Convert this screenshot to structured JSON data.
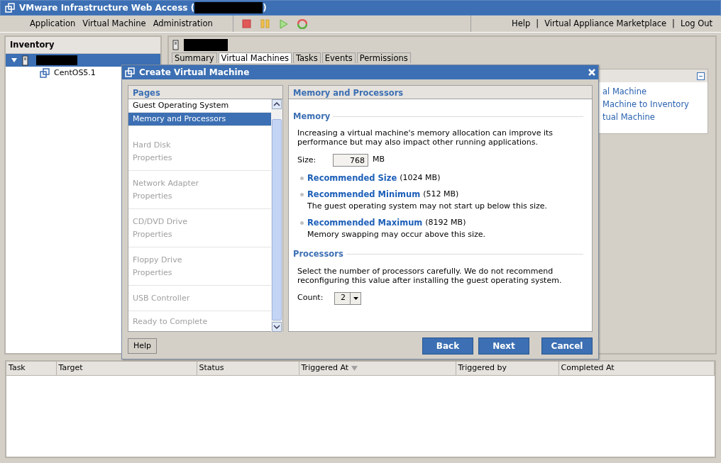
{
  "window": {
    "title_prefix": "VMware Infrastructure Web Access (",
    "title_suffix": ")"
  },
  "menu": [
    "Application",
    "Virtual Machine",
    "Administration"
  ],
  "toolbar": [
    {
      "kind": "stop"
    },
    {
      "kind": "pause"
    },
    {
      "kind": "play"
    },
    {
      "kind": "reset"
    }
  ],
  "top_links": [
    "Help",
    "Virtual Appliance Marketplace",
    "Log Out"
  ],
  "link_separator": "|",
  "inventory": {
    "title": "Inventory",
    "tree": [
      {
        "kind": "host",
        "selected": true,
        "expanded": true,
        "children": [
          {
            "kind": "vm",
            "label": "CentOS5.1",
            "selected": false
          }
        ]
      }
    ]
  },
  "content": {
    "tabs": [
      {
        "label": "Summary",
        "selected": false
      },
      {
        "label": "Virtual Machines",
        "selected": true
      },
      {
        "label": "Tasks",
        "selected": false
      },
      {
        "label": "Events",
        "selected": false
      },
      {
        "label": "Permissions",
        "selected": false
      }
    ],
    "commands": [
      "al Machine",
      "Machine to Inventory",
      "tual Machine"
    ]
  },
  "dialog": {
    "title": "Create Virtual Machine",
    "pages_title": "Pages",
    "pages": [
      {
        "lines": [
          "Guest Operating System"
        ],
        "selected": false,
        "disabled": false
      },
      {
        "lines": [
          "Memory and Processors"
        ],
        "selected": true,
        "disabled": false
      },
      {
        "lines": [
          "Hard Disk",
          "Properties"
        ],
        "selected": false,
        "disabled": true
      },
      {
        "lines": [
          "Network Adapter",
          "Properties"
        ],
        "selected": false,
        "disabled": true
      },
      {
        "lines": [
          "CD/DVD Drive",
          "Properties"
        ],
        "selected": false,
        "disabled": true
      },
      {
        "lines": [
          "Floppy Drive",
          "Properties"
        ],
        "selected": false,
        "disabled": true
      },
      {
        "lines": [
          "USB Controller"
        ],
        "selected": false,
        "disabled": true
      },
      {
        "lines": [
          "Ready to Complete"
        ],
        "selected": false,
        "disabled": true
      }
    ],
    "panel_title": "Memory and Processors",
    "memory": {
      "title": "Memory",
      "description": "Increasing a virtual machine's memory allocation can improve its performance but may also impact other running applications.",
      "size_label": "Size:",
      "size_value": "768",
      "size_unit": "MB",
      "recommendations": [
        {
          "link": "Recommended Size",
          "value": "(1024 MB)"
        },
        {
          "link": "Recommended Minimum",
          "value": "(512 MB)",
          "note": "The guest operating system may not start up below this size."
        },
        {
          "link": "Recommended Maximum",
          "value": "(8192 MB)",
          "note": "Memory swapping may occur above this size."
        }
      ]
    },
    "processors": {
      "title": "Processors",
      "description": "Select the number of processors carefully. We do not recommend reconfiguring this value after installing the guest operating system.",
      "count_label": "Count:",
      "count_value": "2"
    },
    "help_button": "Help",
    "buttons": [
      "Back",
      "Next",
      "Cancel"
    ]
  },
  "tasks": {
    "columns": [
      {
        "label": "Task",
        "sorted": false
      },
      {
        "label": "Target",
        "sorted": false
      },
      {
        "label": "Status",
        "sorted": false
      },
      {
        "label": "Triggered At",
        "sorted": true
      },
      {
        "label": "Triggered by",
        "sorted": false
      },
      {
        "label": "Completed At",
        "sorted": false
      }
    ]
  }
}
